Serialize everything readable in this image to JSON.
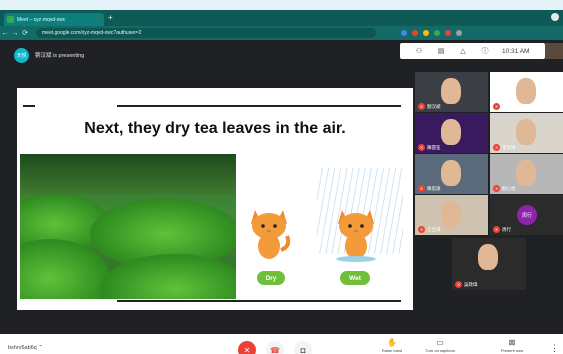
{
  "browser": {
    "tab_title": "Meet – xyz-mqvd-xwc",
    "tab_close": "✕",
    "new_tab": "+",
    "url": "meet.google.com/xyz-mqvd-xwc?authuser=2",
    "nav_back": "←",
    "nav_forward": "→",
    "nav_reload": "⟳",
    "extension_colors": [
      "#4285f4",
      "#ea4335",
      "#fbbc05",
      "#34a853",
      "#ea4335",
      "#9aa0a6"
    ]
  },
  "presenter": {
    "initials": "天悦",
    "text": "劉汉斌 is presenting"
  },
  "toolbar": {
    "time": "10:31 AM"
  },
  "slide": {
    "title": "Next, they dry tea leaves in the air.",
    "dry_label": "Dry",
    "wet_label": "Wet"
  },
  "participants": [
    {
      "name": "劉汉斌",
      "bg": "#3b3f45"
    },
    {
      "name": "周佳思",
      "bg": "#ffffff"
    },
    {
      "name": "陳雲笙",
      "bg": "#3a1a5e"
    },
    {
      "name": "李文博",
      "bg": "#d9d4cc"
    },
    {
      "name": "陳思遠",
      "bg": "#5b6a7a"
    },
    {
      "name": "劉心怡",
      "bg": "#b7b7b7"
    },
    {
      "name": "王佳琪",
      "bg": "#cfc2b0"
    },
    {
      "name": "周行",
      "bg": "#2b2b2b",
      "avatar": "周行",
      "avatar_color": "#8e24aa"
    },
    {
      "name": "吳政瑋",
      "bg": "#2b2b2b"
    }
  ],
  "bottom": {
    "meeting_code": "bshrv6ab6q",
    "raise_hand": "Raise hand",
    "captions": "Turn on captions",
    "present": "Present now",
    "more": "⋮"
  },
  "colors": {
    "accent_teal": "#0f5a57",
    "end_call_red": "#ea4335",
    "tag_green": "#6fbf3a"
  }
}
